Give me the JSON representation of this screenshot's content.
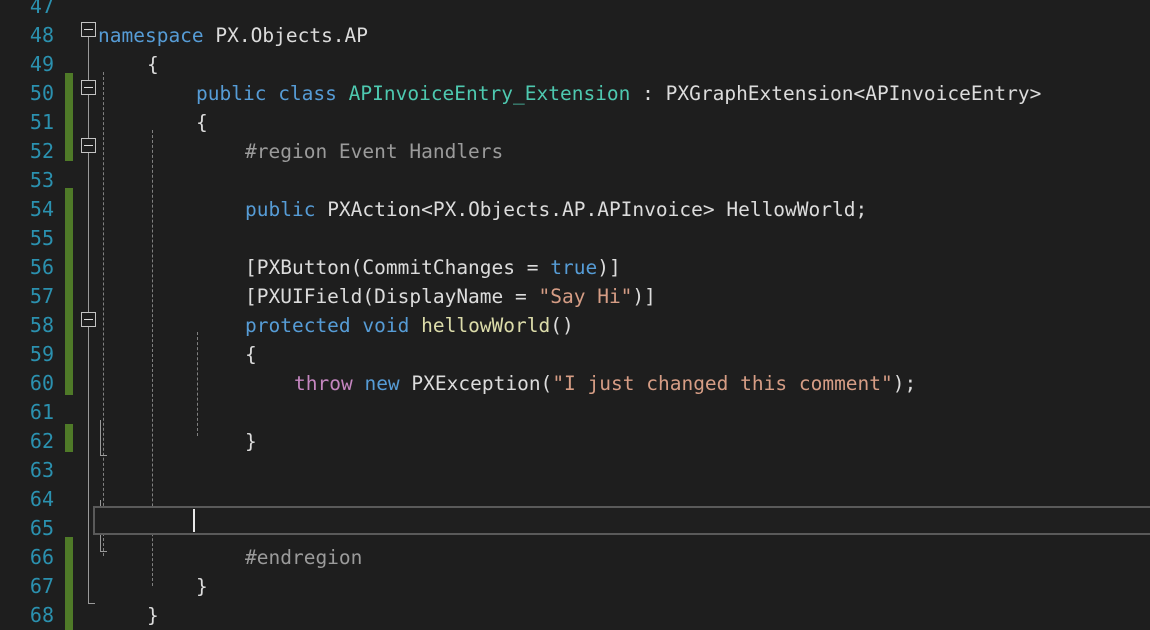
{
  "editor": {
    "app": "visual-studio-code-editor",
    "language": "C#",
    "theme": "dark",
    "background_color": "#1e1e1e",
    "line_number_color": "#2b91af",
    "change_bar_color": "#4f7a28",
    "caret_line": 65,
    "caret_column": 13,
    "first_visible_line": 47,
    "last_visible_line": 68
  },
  "colors": {
    "keyword": "#569cd6",
    "control_keyword": "#c586c0",
    "type": "#4ec9b0",
    "method": "#dcdcaa",
    "string": "#d69d85",
    "preprocessor": "#9b9b9b",
    "plain_text": "#dcdcdc",
    "current_line_border": "#5a5a5a",
    "indent_guide": "#808080",
    "outline_line": "#9a9a9a"
  },
  "lines": [
    {
      "num": "47",
      "clipped": true,
      "tokens": []
    },
    {
      "num": "48",
      "tokens": [
        {
          "t": "namespace ",
          "c": "kw"
        },
        {
          "t": "PX.Objects.AP",
          "c": "pln"
        }
      ]
    },
    {
      "num": "49",
      "tokens": [
        {
          "t": "{",
          "c": "pln"
        }
      ]
    },
    {
      "num": "50",
      "tokens": [
        {
          "t": "public ",
          "c": "kw"
        },
        {
          "t": "class ",
          "c": "kw"
        },
        {
          "t": "APInvoiceEntry_Extension",
          "c": "typ"
        },
        {
          "t": " : PXGraphExtension<APInvoiceEntry>",
          "c": "pln"
        }
      ]
    },
    {
      "num": "51",
      "tokens": [
        {
          "t": "{",
          "c": "pln"
        }
      ]
    },
    {
      "num": "52",
      "tokens": [
        {
          "t": "#region Event Handlers",
          "c": "pre"
        }
      ]
    },
    {
      "num": "53",
      "tokens": []
    },
    {
      "num": "54",
      "tokens": [
        {
          "t": "public ",
          "c": "kw"
        },
        {
          "t": "PXAction<PX.Objects.AP.APInvoice> HellowWorld;",
          "c": "pln"
        }
      ]
    },
    {
      "num": "55",
      "tokens": []
    },
    {
      "num": "56",
      "tokens": [
        {
          "t": "[PXButton(CommitChanges = ",
          "c": "pln"
        },
        {
          "t": "true",
          "c": "kw"
        },
        {
          "t": ")]",
          "c": "pln"
        }
      ]
    },
    {
      "num": "57",
      "tokens": [
        {
          "t": "[PXUIField(DisplayName = ",
          "c": "pln"
        },
        {
          "t": "\"Say Hi\"",
          "c": "str"
        },
        {
          "t": ")]",
          "c": "pln"
        }
      ]
    },
    {
      "num": "58",
      "tokens": [
        {
          "t": "protected ",
          "c": "kw"
        },
        {
          "t": "void ",
          "c": "kw"
        },
        {
          "t": "hellowWorld",
          "c": "fn"
        },
        {
          "t": "()",
          "c": "pln"
        }
      ]
    },
    {
      "num": "59",
      "tokens": [
        {
          "t": "{",
          "c": "pln"
        }
      ]
    },
    {
      "num": "60",
      "tokens": [
        {
          "t": "throw ",
          "c": "ctl"
        },
        {
          "t": "new ",
          "c": "kw"
        },
        {
          "t": "PXException(",
          "c": "pln"
        },
        {
          "t": "\"I just changed this comment\"",
          "c": "str"
        },
        {
          "t": ");",
          "c": "pln"
        }
      ]
    },
    {
      "num": "61",
      "tokens": []
    },
    {
      "num": "62",
      "tokens": [
        {
          "t": "}",
          "c": "pln"
        }
      ]
    },
    {
      "num": "63",
      "tokens": []
    },
    {
      "num": "64",
      "tokens": []
    },
    {
      "num": "65",
      "tokens": [],
      "current": true
    },
    {
      "num": "66",
      "tokens": [
        {
          "t": "#endregion",
          "c": "pre"
        }
      ]
    },
    {
      "num": "67",
      "tokens": [
        {
          "t": "}",
          "c": "pln"
        }
      ]
    },
    {
      "num": "68",
      "tokens": [
        {
          "t": "}",
          "c": "pln"
        }
      ]
    }
  ],
  "line_indents": {
    "47": 0,
    "48": 0,
    "49": 1,
    "50": 2,
    "51": 2,
    "52": 3,
    "53": 0,
    "54": 3,
    "55": 0,
    "56": 3,
    "57": 3,
    "58": 3,
    "59": 3,
    "60": 4,
    "61": 0,
    "62": 3,
    "63": 0,
    "64": 0,
    "65": 0,
    "66": 3,
    "67": 2,
    "68": 1
  },
  "change_bars": [
    {
      "from_line": "50",
      "to_line": "52",
      "color": "#4f7a28"
    },
    {
      "from_line": "54",
      "to_line": "61",
      "color": "#4f7a28"
    },
    {
      "from_line": "62",
      "to_line": "62",
      "color": "#4f7a28"
    },
    {
      "from_line": "66",
      "to_line": "68",
      "color": "#4f7a28"
    }
  ],
  "collapse_icons": [
    {
      "line": "48",
      "state": "expanded",
      "glyph": "minus-box"
    },
    {
      "line": "50",
      "state": "expanded",
      "glyph": "minus-box"
    },
    {
      "line": "52",
      "state": "expanded",
      "glyph": "minus-box"
    },
    {
      "line": "58",
      "state": "expanded",
      "glyph": "minus-box"
    }
  ]
}
